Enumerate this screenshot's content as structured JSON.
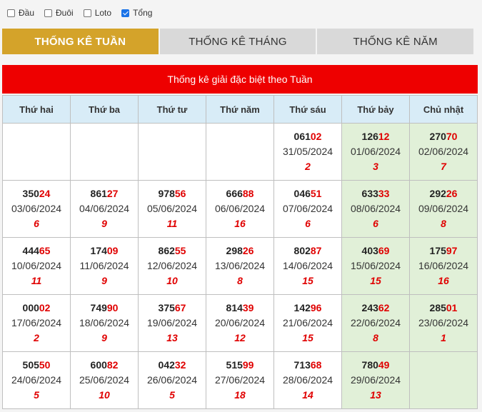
{
  "filters": [
    {
      "label": "Đầu",
      "checked": false
    },
    {
      "label": "Đuôi",
      "checked": false
    },
    {
      "label": "Loto",
      "checked": false
    },
    {
      "label": "Tổng",
      "checked": true
    }
  ],
  "tabs": [
    {
      "label": "THỐNG KÊ TUẦN",
      "active": true
    },
    {
      "label": "THỐNG KÊ THÁNG",
      "active": false
    },
    {
      "label": "THỐNG KÊ NĂM",
      "active": false
    }
  ],
  "panel": {
    "title": "Thống kê giải đặc biệt theo Tuần"
  },
  "colors": {
    "accent_tab": "#d4a32a",
    "title_bar": "#ee0000",
    "highlight": "#e00000",
    "header_bg": "#d8ecf7",
    "weekend_bg": "#e1f0d8"
  },
  "table": {
    "headers": [
      "Thứ hai",
      "Thứ ba",
      "Thứ tư",
      "Thứ năm",
      "Thứ sáu",
      "Thứ bảy",
      "Chủ nhật"
    ],
    "rows": [
      [
        null,
        null,
        null,
        null,
        {
          "head": "061",
          "tail": "02",
          "date": "31/05/2024",
          "sum": "2"
        },
        {
          "head": "126",
          "tail": "12",
          "date": "01/06/2024",
          "sum": "3"
        },
        {
          "head": "270",
          "tail": "70",
          "date": "02/06/2024",
          "sum": "7"
        }
      ],
      [
        {
          "head": "350",
          "tail": "24",
          "date": "03/06/2024",
          "sum": "6"
        },
        {
          "head": "861",
          "tail": "27",
          "date": "04/06/2024",
          "sum": "9"
        },
        {
          "head": "978",
          "tail": "56",
          "date": "05/06/2024",
          "sum": "11"
        },
        {
          "head": "666",
          "tail": "88",
          "date": "06/06/2024",
          "sum": "16"
        },
        {
          "head": "046",
          "tail": "51",
          "date": "07/06/2024",
          "sum": "6"
        },
        {
          "head": "633",
          "tail": "33",
          "date": "08/06/2024",
          "sum": "6"
        },
        {
          "head": "292",
          "tail": "26",
          "date": "09/06/2024",
          "sum": "8"
        }
      ],
      [
        {
          "head": "444",
          "tail": "65",
          "date": "10/06/2024",
          "sum": "11"
        },
        {
          "head": "174",
          "tail": "09",
          "date": "11/06/2024",
          "sum": "9"
        },
        {
          "head": "862",
          "tail": "55",
          "date": "12/06/2024",
          "sum": "10"
        },
        {
          "head": "298",
          "tail": "26",
          "date": "13/06/2024",
          "sum": "8"
        },
        {
          "head": "802",
          "tail": "87",
          "date": "14/06/2024",
          "sum": "15"
        },
        {
          "head": "403",
          "tail": "69",
          "date": "15/06/2024",
          "sum": "15"
        },
        {
          "head": "175",
          "tail": "97",
          "date": "16/06/2024",
          "sum": "16"
        }
      ],
      [
        {
          "head": "000",
          "tail": "02",
          "date": "17/06/2024",
          "sum": "2"
        },
        {
          "head": "749",
          "tail": "90",
          "date": "18/06/2024",
          "sum": "9"
        },
        {
          "head": "375",
          "tail": "67",
          "date": "19/06/2024",
          "sum": "13"
        },
        {
          "head": "814",
          "tail": "39",
          "date": "20/06/2024",
          "sum": "12"
        },
        {
          "head": "142",
          "tail": "96",
          "date": "21/06/2024",
          "sum": "15"
        },
        {
          "head": "243",
          "tail": "62",
          "date": "22/06/2024",
          "sum": "8"
        },
        {
          "head": "285",
          "tail": "01",
          "date": "23/06/2024",
          "sum": "1"
        }
      ],
      [
        {
          "head": "505",
          "tail": "50",
          "date": "24/06/2024",
          "sum": "5"
        },
        {
          "head": "600",
          "tail": "82",
          "date": "25/06/2024",
          "sum": "10"
        },
        {
          "head": "042",
          "tail": "32",
          "date": "26/06/2024",
          "sum": "5"
        },
        {
          "head": "515",
          "tail": "99",
          "date": "27/06/2024",
          "sum": "18"
        },
        {
          "head": "713",
          "tail": "68",
          "date": "28/06/2024",
          "sum": "14"
        },
        {
          "head": "780",
          "tail": "49",
          "date": "29/06/2024",
          "sum": "13"
        },
        null
      ]
    ]
  }
}
